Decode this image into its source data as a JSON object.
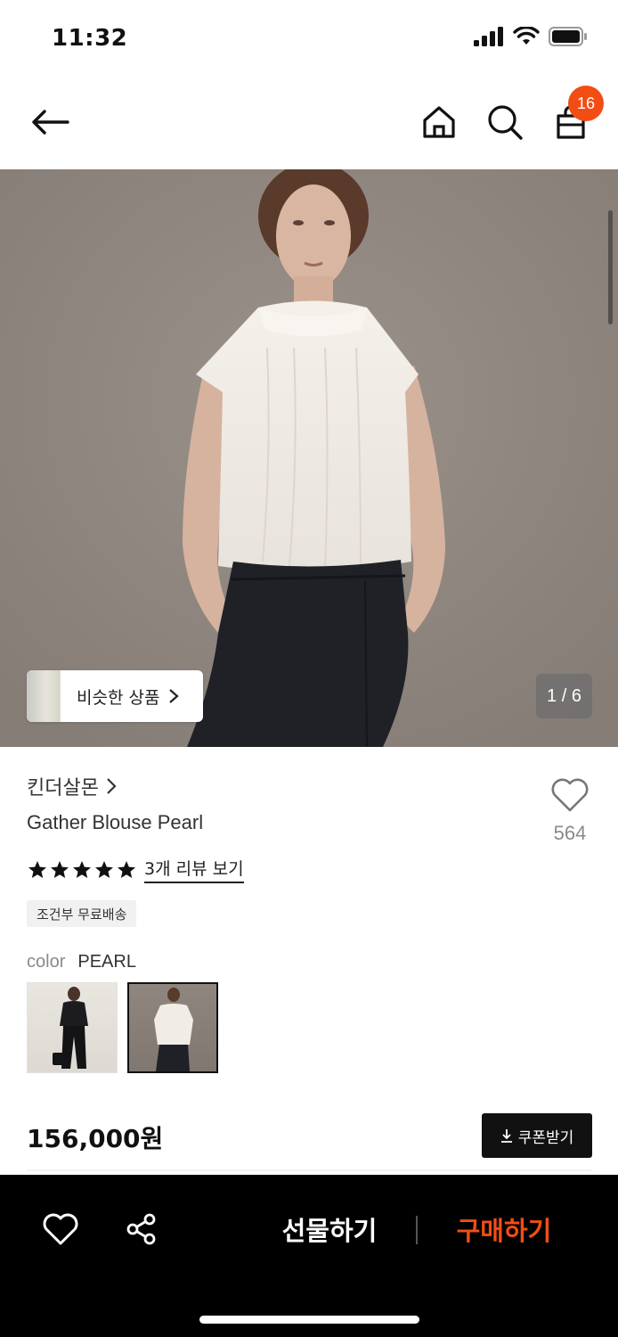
{
  "status_bar": {
    "time": "11:32"
  },
  "header": {
    "cart_count": "16"
  },
  "gallery": {
    "similar_label": "비슷한 상품",
    "page_counter": "1 / 6"
  },
  "product": {
    "brand": "킨더살몬",
    "title": "Gather Blouse Pearl",
    "wish_count": "564",
    "rating_stars": 5,
    "review_link": "3개 리뷰 보기",
    "shipping_badge": "조건부 무료배송",
    "color_label": "color",
    "color_value": "PEARL",
    "price": "156,000원",
    "coupon_label": "쿠폰받기"
  },
  "bottom_bar": {
    "gift_label": "선물하기",
    "buy_label": "구매하기"
  },
  "colors": {
    "accent": "#f24d14",
    "bar": "#000000"
  }
}
